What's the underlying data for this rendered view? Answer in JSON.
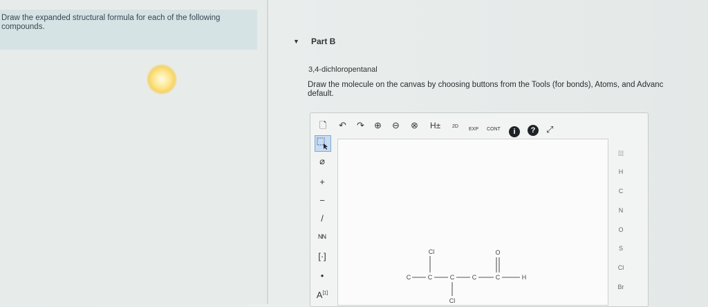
{
  "prompt": {
    "text": "Draw the expanded structural formula for each of the following compounds."
  },
  "part": {
    "toggle": "▼",
    "label": "Part B"
  },
  "compound": {
    "name": "3,4-dichloropentanal"
  },
  "instructions": {
    "line1": "Draw the molecule on the canvas by choosing buttons from the Tools (for bonds), Atoms, and Advanc",
    "line2": "default."
  },
  "toolbar": {
    "new": "🗋",
    "undo": "↶",
    "redo": "↷",
    "zoom_in": "⊕",
    "zoom_out": "⊖",
    "zoom_reset": "⊗",
    "h_toggle": "H±",
    "template_label": "2D",
    "exp_label": "EXP",
    "cont_label": "CONT",
    "info": "i",
    "help": "?",
    "fullscreen": "⤢"
  },
  "left_tools": {
    "erase": "⌀",
    "plus": "+",
    "minus": "−",
    "bond": "/",
    "chain": "ᴺᴺ",
    "bracket": "[·]",
    "dot": "•",
    "atom_label": "A",
    "atom_sup": "[1]"
  },
  "atoms": [
    "H",
    "C",
    "N",
    "O",
    "S",
    "Cl",
    "Br"
  ],
  "periodic_label": "⁞⁞⁞",
  "molecule": {
    "atoms": [
      "C",
      "C",
      "C",
      "C",
      "C",
      "H",
      "O",
      "Cl",
      "Cl"
    ]
  }
}
